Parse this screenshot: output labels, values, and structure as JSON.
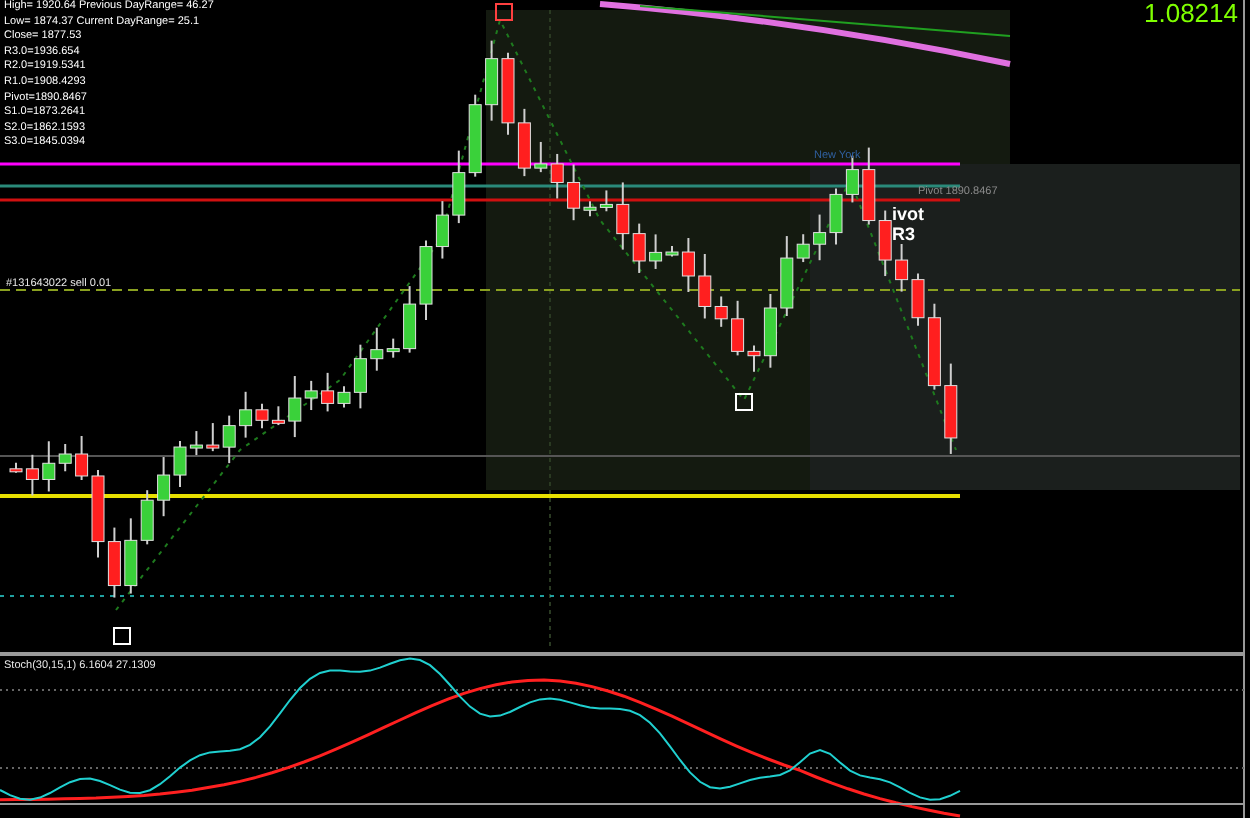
{
  "price": "1.08214",
  "info_lines": [
    "High= 1920.64 Previous DayRange= 46.27",
    "Low= 1874.37 Current DayRange= 25.1",
    "Close= 1877.53",
    "R3.0=1936.654",
    "R2.0=1919.5341",
    "R1.0=1908.4293",
    "Pivot=1890.8467",
    "S1.0=1873.2641",
    "S2.0=1862.1593",
    "S3.0=1845.0394"
  ],
  "order_label": "#131643022 sell 0.01",
  "session_label": "New York",
  "pivot_label": "Pivot 1890.8467",
  "pivot_r3_label": {
    "line_1": "ivot",
    "line_2": "R3"
  },
  "indicator_label": "Stoch(30,15,1) 6.1604 27.1309"
}
